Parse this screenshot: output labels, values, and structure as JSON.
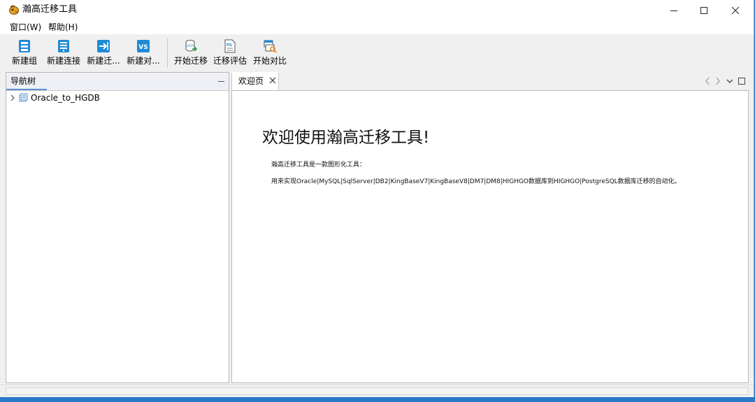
{
  "window": {
    "title": "瀚高迁移工具",
    "controls": {
      "minimize": "minimize",
      "maximize": "maximize",
      "close": "close"
    }
  },
  "menubar": {
    "items": [
      "窗口(W)",
      "帮助(H)"
    ]
  },
  "toolbar": {
    "buttons": [
      {
        "label": "新建组",
        "icon": "new-group-icon"
      },
      {
        "label": "新建连接",
        "icon": "new-connection-icon"
      },
      {
        "label": "新建迁...",
        "icon": "new-migration-icon"
      },
      {
        "label": "新建对...",
        "icon": "new-compare-icon"
      },
      {
        "label": "开始迁移",
        "icon": "start-migration-icon"
      },
      {
        "label": "迁移评估",
        "icon": "migration-assessment-icon"
      },
      {
        "label": "开始对比",
        "icon": "start-compare-icon"
      }
    ]
  },
  "navigator": {
    "tab_label": "导航树",
    "tree": [
      {
        "label": "Oracle_to_HGDB",
        "icon": "group-folder-icon",
        "expanded": false
      }
    ]
  },
  "editor": {
    "tabs": [
      {
        "label": "欢迎页",
        "closable": true
      }
    ],
    "welcome": {
      "heading": "欢迎使用瀚高迁移工具!",
      "line1": "瀚高迁移工具是一款图形化工具：",
      "line2": "用来实现Oracle|MySQL|SqlServer|DB2|KingBaseV7|KingBaseV8|DM7|DM8|HIGHGO数据库到HIGHGO|PostgreSQL数据库迁移的自动化。"
    }
  },
  "colors": {
    "accent": "#5a8fd3",
    "icon_blue": "#1f8ad6",
    "desktop": "#2a78c8"
  }
}
